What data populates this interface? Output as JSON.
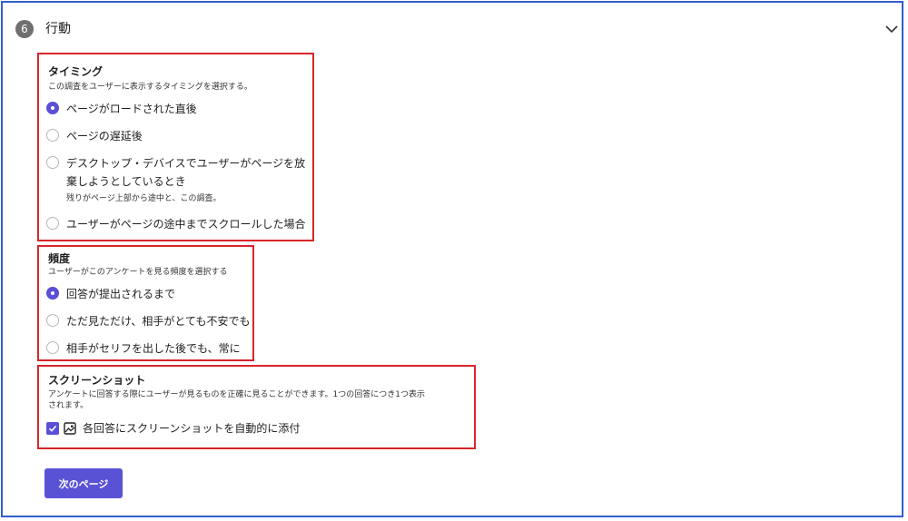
{
  "section": {
    "number": "6",
    "title": "行動"
  },
  "timing": {
    "title": "タイミング",
    "description": "この調査をユーザーに表示するタイミングを選択する。",
    "options": [
      {
        "label": "ページがロードされた直後",
        "selected": true
      },
      {
        "label": "ページの遅延後",
        "selected": false
      },
      {
        "label_line1": "デスクトップ・デバイスでユーザーがページを放",
        "label_line2": "棄しようとしているとき",
        "sublabel": "残りがページ上部から途中と、この調査。",
        "selected": false
      },
      {
        "label": "ユーザーがページの途中までスクロールした場合",
        "selected": false
      }
    ]
  },
  "frequency": {
    "title": "頻度",
    "description": "ユーザーがこのアンケートを見る頻度を選択する",
    "options": [
      {
        "label": "回答が提出されるまで",
        "selected": true
      },
      {
        "label": "ただ見ただけ、相手がとても不安でも",
        "selected": false
      },
      {
        "label": "相手がセリフを出した後でも、常に",
        "selected": false
      }
    ]
  },
  "screenshot": {
    "title": "スクリーンショット",
    "description_line1": "アンケートに回答する際にユーザーが見るものを正確に見ることができます。1つの回答につき1つ表示",
    "description_line2": "されます。",
    "checkbox_label": "各回答にスクリーンショットを自動的に添付",
    "checked": true
  },
  "next_button": {
    "label": "次のページ"
  },
  "colors": {
    "accent": "#5a52d5",
    "highlight_border": "#d9252b",
    "frame_border": "#2f5fd0"
  }
}
